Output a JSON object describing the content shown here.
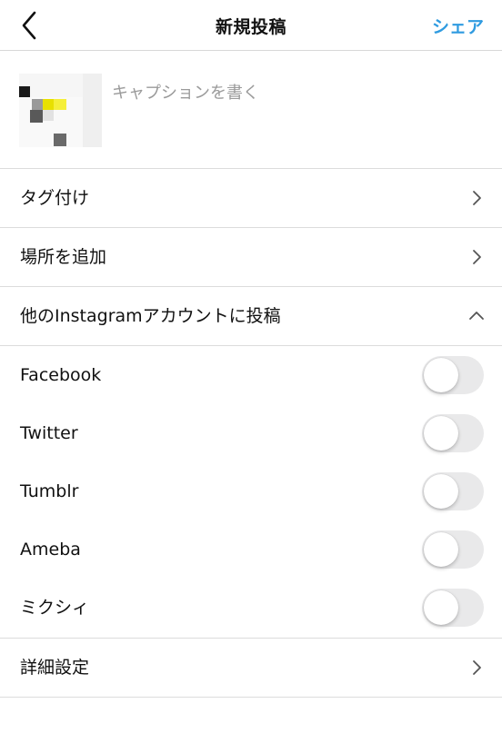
{
  "header": {
    "title": "新規投稿",
    "share_label": "シェア",
    "back_icon": "chevron-left-icon"
  },
  "compose": {
    "caption_placeholder": "キャプションを書く",
    "caption_value": ""
  },
  "rows": {
    "tag": "タグ付け",
    "location": "場所を追加",
    "other_accounts": "他のInstagramアカウントに投稿",
    "advanced": "詳細設定"
  },
  "share_targets": [
    {
      "label": "Facebook",
      "enabled": false
    },
    {
      "label": "Twitter",
      "enabled": false
    },
    {
      "label": "Tumblr",
      "enabled": false
    },
    {
      "label": "Ameba",
      "enabled": false
    },
    {
      "label": "ミクシィ",
      "enabled": false
    }
  ],
  "colors": {
    "accent": "#2f9be0",
    "toggle_off": "#e9e9ea",
    "divider": "#dcdcdc"
  }
}
